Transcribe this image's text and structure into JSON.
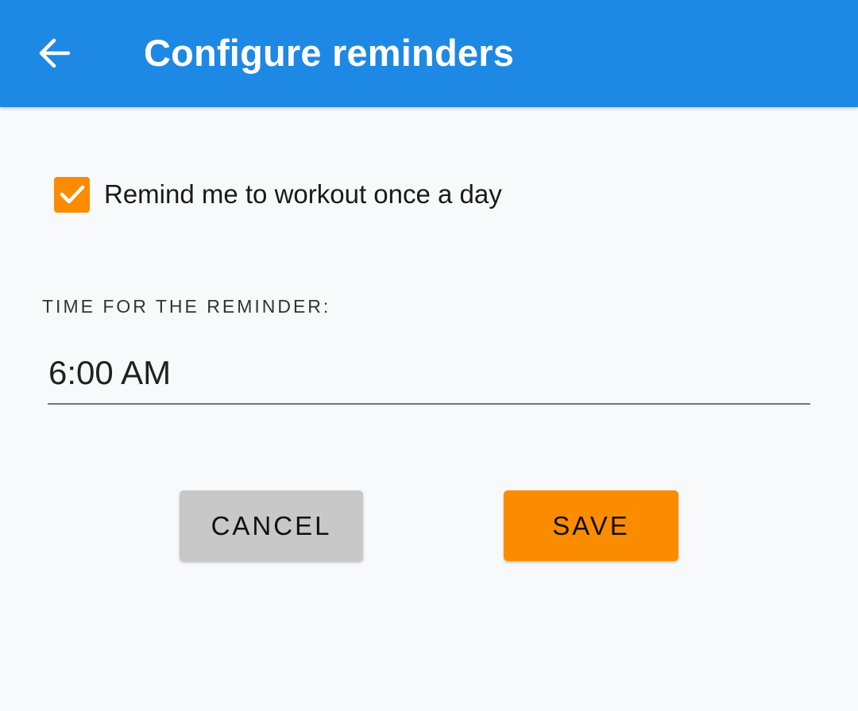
{
  "app_bar": {
    "title": "Configure reminders",
    "back_icon": "arrow-left-icon",
    "color": "#1e88e5"
  },
  "reminder": {
    "checkbox_label": "Remind me to workout once a day",
    "checked": true,
    "check_icon": "checkmark-icon",
    "checkbox_color": "#fb8c00"
  },
  "time_section": {
    "label": "TIME FOR THE REMINDER:",
    "value": "6:00 AM"
  },
  "actions": {
    "cancel_label": "CANCEL",
    "save_label": "SAVE",
    "cancel_color": "#c8c8c8",
    "save_color": "#fb8c00"
  }
}
